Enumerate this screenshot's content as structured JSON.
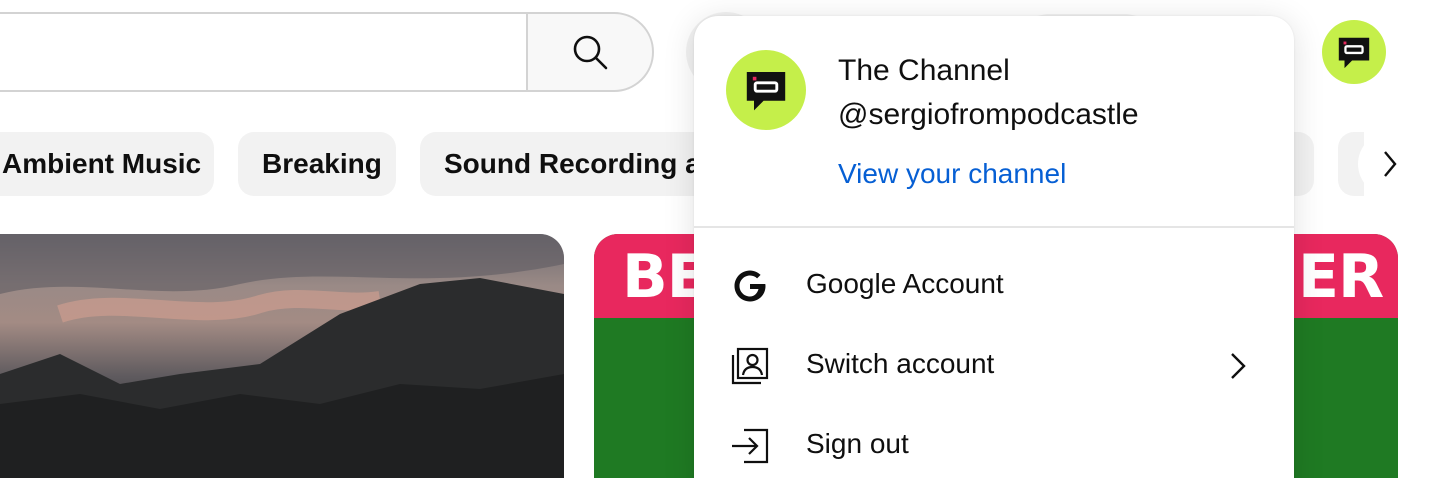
{
  "header": {
    "search_placeholder": "",
    "icons": {
      "search": "search-icon",
      "avatar": "channel-logo"
    }
  },
  "chips": [
    {
      "label": "Ambient Music"
    },
    {
      "label": "Breaking"
    },
    {
      "label": "Sound Recording and Reproduction"
    }
  ],
  "thumbnails": [
    {
      "overlay_left": "BE",
      "overlay_right": "ER"
    }
  ],
  "account_menu": {
    "channel_name": "The Channel",
    "handle": "@sergiofrompodcastle",
    "view_channel": "View your channel",
    "items": [
      {
        "label": "Google Account",
        "icon": "google-icon"
      },
      {
        "label": "Switch account",
        "icon": "switch-account-icon"
      },
      {
        "label": "Sign out",
        "icon": "sign-out-icon"
      }
    ]
  },
  "colors": {
    "accent_link": "#065fd4",
    "avatar_bg": "#c5ef4a",
    "chip_bg": "#f2f2f2",
    "thumb_band": "#e8285e",
    "thumb_green": "#1f7a23"
  }
}
